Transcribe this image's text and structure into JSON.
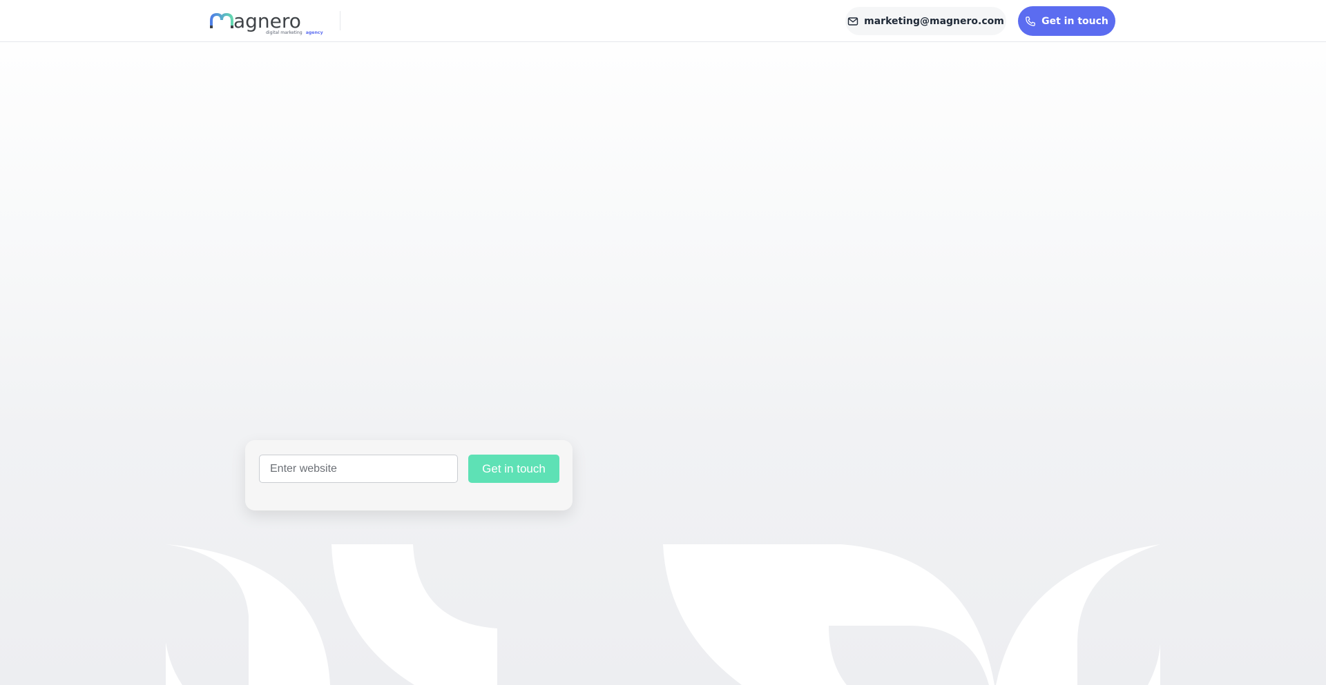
{
  "header": {
    "logo": {
      "wordmark": "magnero",
      "tagline_prefix": "digital marketing",
      "tagline_suffix": "agency",
      "colors": {
        "m_gradient_start": "#4f7fe6",
        "m_gradient_end": "#64d8b0",
        "text": "#3f4347",
        "tagline": "#5b6270",
        "agency": "#5b6cf0"
      }
    },
    "email": {
      "icon": "mail-icon",
      "text": "marketing@magnero.com"
    },
    "cta": {
      "icon": "phone-icon",
      "label": "Get in touch"
    }
  },
  "hero": {
    "form": {
      "website_placeholder": "Enter website",
      "website_value": "",
      "submit_label": "Get in touch"
    }
  },
  "colors": {
    "primary": "#5b6cf0",
    "accent_green": "#5ee1b5",
    "header_border": "#e5e7eb",
    "hero_background": "#eeeff2"
  }
}
